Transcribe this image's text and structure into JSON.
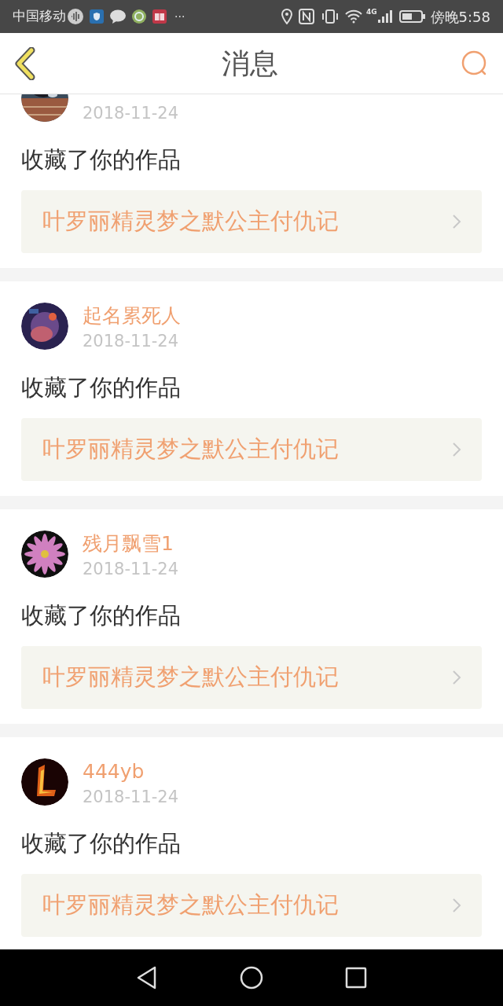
{
  "status_bar": {
    "carrier": "中国移动",
    "more": "···",
    "network": "4G",
    "time": "傍晚5:58"
  },
  "header": {
    "title": "消息"
  },
  "messages": [
    {
      "date": "2018-11-24",
      "action": "收藏了你的作品",
      "work": "叶罗丽精灵梦之默公主付仇记"
    },
    {
      "name": "起名累死人",
      "date": "2018-11-24",
      "action": "收藏了你的作品",
      "work": "叶罗丽精灵梦之默公主付仇记"
    },
    {
      "name": "残月飘雪1",
      "date": "2018-11-24",
      "action": "收藏了你的作品",
      "work": "叶罗丽精灵梦之默公主付仇记"
    },
    {
      "name": "444yb",
      "date": "2018-11-24",
      "action": "收藏了你的作品",
      "work": "叶罗丽精灵梦之默公主付仇记"
    }
  ]
}
